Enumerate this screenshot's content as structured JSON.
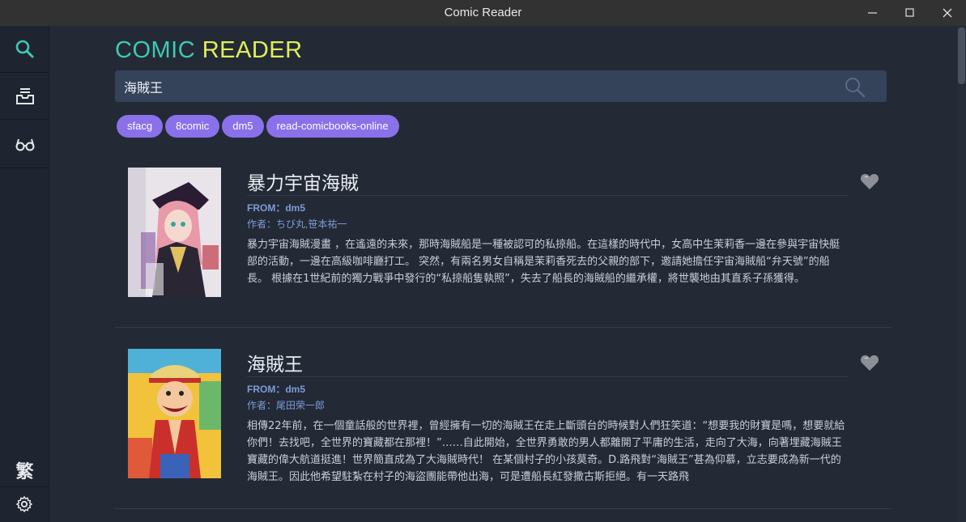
{
  "window": {
    "title": "Comic Reader"
  },
  "sidebar": {
    "items": [
      {
        "icon": "search-icon"
      },
      {
        "icon": "inbox-icon"
      },
      {
        "icon": "glasses-icon"
      }
    ],
    "language_label": "繁",
    "settings_icon": "gear-icon"
  },
  "brand": {
    "part1": "COMIC",
    "part2": "READER",
    "color1": "#3ec9b2",
    "color2": "#e2ee58"
  },
  "search": {
    "value": "海賊王",
    "placeholder": ""
  },
  "sources": [
    "sfacg",
    "8comic",
    "dm5",
    "read-comicbooks-online"
  ],
  "results": [
    {
      "title": "暴力宇宙海賊",
      "from": "FROM：dm5",
      "author": "作者：ちび丸,笹本祐一",
      "description": "暴力宇宙海賊漫畫 ，在遙遠的未來，那時海賊船是一種被認可的私掠船。在這樣的時代中，女高中生茉莉香一邊在參與宇宙快艇部的活動，一邊在高級咖啡廳打工。 突然，有兩名男女自稱是茉莉香死去的父親的部下，邀請她擔任宇宙海賊船“弁天號”的船長。 根據在1世紀前的獨力戰爭中發行的“私掠船隻執照”，失去了船長的海賊船的繼承權，將世襲地由其直系子孫獲得。"
    },
    {
      "title": "海賊王",
      "from": "FROM：dm5",
      "author": "作者：尾田荣一郎",
      "description": "相傳22年前，在一個童話般的世界裡，曾經擁有一切的海賊王在走上斷頭台的時候對人們狂笑道：“想要我的財寶是嗎，想要就給你們！去找吧，全世界的寶藏都在那裡！”……自此開始，全世界勇敢的男人都離開了平庸的生活，走向了大海，向著埋藏海賊王寶藏的偉大航道挺進！世界簡直成為了大海賊時代！ 在某個村子的小孩莫奇。D.路飛對“海賊王”甚為仰慕，立志要成為新一代的海賊王。因此他希望駐紮在村子的海盜團能帶他出海，可是遭船長紅發撒古斯拒絕。有一天路飛"
    }
  ],
  "colors": {
    "accent": "#3ec9b2",
    "chip": "#8a71ea",
    "meta": "#7f9bd8",
    "background": "#232a36"
  }
}
